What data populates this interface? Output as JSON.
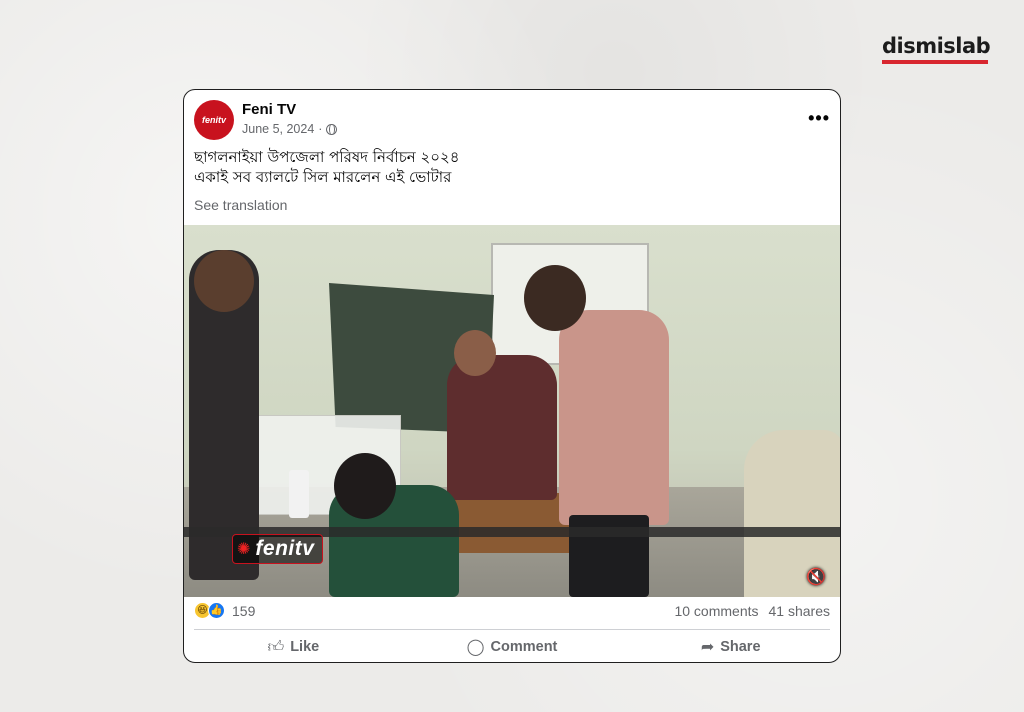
{
  "brand": {
    "name": "dismislab",
    "accent": "#d8262f"
  },
  "post": {
    "page_name": "Feni TV",
    "avatar_text": "fenitv",
    "date": "June 5, 2024",
    "separator": "·",
    "audience_icon": "globe-icon",
    "more_label": "•••",
    "caption_line1": "ছাগলনাইয়া উপজেলা পরিষদ নির্বাচন ২০২৪",
    "caption_line2": "একাই সব ব্যালটে সিল মারলেন এই ভোটার",
    "see_translation": "See translation",
    "video_watermark": "fenitv",
    "reaction_count": "159",
    "comments": "10 comments",
    "shares": "41 shares",
    "actions": {
      "like": "Like",
      "comment": "Comment",
      "share": "Share"
    },
    "colors": {
      "avatar_bg": "#c8121e",
      "like_blue": "#1877f2",
      "haha_yellow": "#f7c530"
    }
  }
}
